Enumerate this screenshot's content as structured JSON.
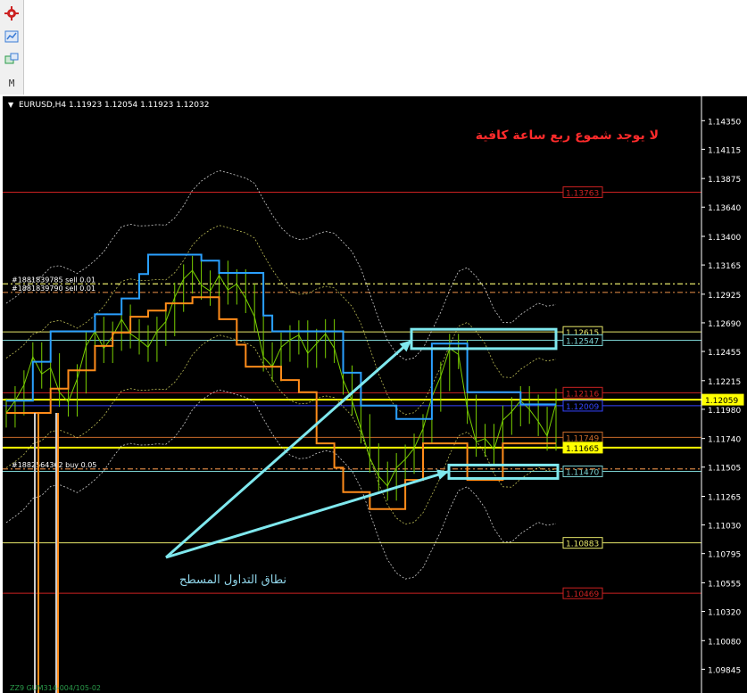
{
  "toolbar": {
    "tools": [
      {
        "icon": "gear-icon",
        "color": "#cc2222"
      },
      {
        "icon": "chart-icon",
        "color": "#3a7bd5"
      },
      {
        "icon": "network-icon",
        "color": "#2a9a4a"
      }
    ],
    "partial_label": "M"
  },
  "chart_data": {
    "type": "line",
    "header": {
      "symbol": "EURUSD,H4",
      "ohlc": [
        "1.11923",
        "1.12054",
        "1.11923",
        "1.12032"
      ]
    },
    "annotation_top": "لا يوجد شموع ربع ساعة كافية",
    "annotation_bottom": "نطاق التداول المسطح",
    "ylim": [
      1.0965,
      1.1455
    ],
    "y_ticks": [
      "1.14350",
      "1.14115",
      "1.13875",
      "1.13640",
      "1.13400",
      "1.13165",
      "1.12925",
      "1.12690",
      "1.12455",
      "1.12215",
      "1.11980",
      "1.11740",
      "1.11505",
      "1.11265",
      "1.11030",
      "1.10795",
      "1.10555",
      "1.10320",
      "1.10080",
      "1.09845"
    ],
    "current_price": "1.12059",
    "horizontal_levels": [
      {
        "label": "1.13763",
        "value": 1.13763,
        "color": "#cc2222",
        "style": "solid"
      },
      {
        "label": "1.12615",
        "value": 1.12615,
        "color": "#e8e86a",
        "style": "solid"
      },
      {
        "label": "1.12547",
        "value": 1.12547,
        "color": "#7ad0d0",
        "style": "solid"
      },
      {
        "label": "1.12116",
        "value": 1.12116,
        "color": "#cc2222",
        "style": "solid"
      },
      {
        "label": "1.12059",
        "value": 1.12059,
        "color": "#ffff00",
        "style": "solid"
      },
      {
        "label": "1.12009",
        "value": 1.12009,
        "color": "#3344ff",
        "style": "solid"
      },
      {
        "label": "1.11749",
        "value": 1.11749,
        "color": "#c86a2a",
        "style": "solid"
      },
      {
        "label": "1.11665",
        "value": 1.11665,
        "color": "#ffff00",
        "style": "solid"
      },
      {
        "label": "1.11470",
        "value": 1.1147,
        "color": "#7ad0d0",
        "style": "solid"
      },
      {
        "label": "1.10883",
        "value": 1.10883,
        "color": "#e8e86a",
        "style": "solid"
      },
      {
        "label": "1.10469",
        "value": 1.10469,
        "color": "#cc2222",
        "style": "solid"
      }
    ],
    "order_lines": [
      {
        "label": "#1881839785  sell 0.01",
        "value": 1.1301,
        "color": "#e8e86a"
      },
      {
        "label": "#1881839790  sell 0.01",
        "value": 1.1294,
        "color": "#d08040"
      },
      {
        "label": "#1882564362  buy 0.05",
        "value": 1.1149,
        "color": "#d08040"
      }
    ],
    "rectangles": [
      {
        "from": 1.12637,
        "to": 1.12478
      },
      {
        "from": 1.11522,
        "to": 1.11412
      }
    ],
    "indicator_label": "ZZ9 GUM314-004/105-02",
    "series": [
      {
        "name": "",
        "color": "#7ad000",
        "values": [
          1.1195,
          1.1205,
          1.1218,
          1.1241,
          1.1227,
          1.1232,
          1.1212,
          1.1204,
          1.1223,
          1.125,
          1.1262,
          1.1248,
          1.1258,
          1.1272,
          1.126,
          1.1255,
          1.1249,
          1.1262,
          1.127,
          1.129,
          1.1305,
          1.1312,
          1.13,
          1.1295,
          1.1308,
          1.1296,
          1.1301,
          1.1289,
          1.1274,
          1.1241,
          1.1233,
          1.1249,
          1.1255,
          1.1259,
          1.1244,
          1.1252,
          1.126,
          1.1248,
          1.1222,
          1.1205,
          1.1182,
          1.1158,
          1.1143,
          1.1135,
          1.115,
          1.1157,
          1.1166,
          1.1182,
          1.1208,
          1.1225,
          1.1248,
          1.1243,
          1.1198,
          1.1171,
          1.1174,
          1.1165,
          1.1189,
          1.1196,
          1.1205,
          1.1198,
          1.1188,
          1.1176,
          1.1203
        ]
      },
      {
        "name": "",
        "color": "#2aa0ff",
        "values": [
          1.1205,
          1.1205,
          1.1205,
          1.1237,
          1.1237,
          1.1262,
          1.1262,
          1.1262,
          1.1262,
          1.1262,
          1.1276,
          1.1276,
          1.1276,
          1.1289,
          1.1289,
          1.1309,
          1.1325,
          1.1325,
          1.1325,
          1.1325,
          1.1325,
          1.1325,
          1.132,
          1.132,
          1.131,
          1.131,
          1.131,
          1.131,
          1.131,
          1.1275,
          1.1262,
          1.1262,
          1.1262,
          1.1262,
          1.1262,
          1.1262,
          1.1262,
          1.1262,
          1.1228,
          1.1228,
          1.1201,
          1.1201,
          1.1201,
          1.1201,
          1.119,
          1.119,
          1.119,
          1.119,
          1.1252,
          1.1252,
          1.1252,
          1.1252,
          1.1212,
          1.1212,
          1.1212,
          1.1212,
          1.1212,
          1.1212,
          1.1202,
          1.1202,
          1.1202,
          1.1202,
          1.1202
        ]
      },
      {
        "name": "",
        "color": "#ff8c1a",
        "values": [
          1.1195,
          1.1195,
          1.1195,
          1.1195,
          1.1195,
          1.1215,
          1.1215,
          1.123,
          1.123,
          1.123,
          1.125,
          1.125,
          1.1261,
          1.1261,
          1.1274,
          1.1274,
          1.1279,
          1.1279,
          1.1285,
          1.1285,
          1.1285,
          1.129,
          1.129,
          1.129,
          1.1272,
          1.1272,
          1.1251,
          1.1233,
          1.1233,
          1.1233,
          1.1233,
          1.1222,
          1.1222,
          1.1212,
          1.1212,
          1.117,
          1.117,
          1.115,
          1.113,
          1.113,
          1.113,
          1.1116,
          1.1116,
          1.1116,
          1.1116,
          1.114,
          1.114,
          1.117,
          1.117,
          1.117,
          1.117,
          1.117,
          1.114,
          1.114,
          1.114,
          1.114,
          1.117,
          1.117,
          1.117,
          1.117,
          1.117,
          1.117,
          1.117
        ]
      }
    ]
  }
}
